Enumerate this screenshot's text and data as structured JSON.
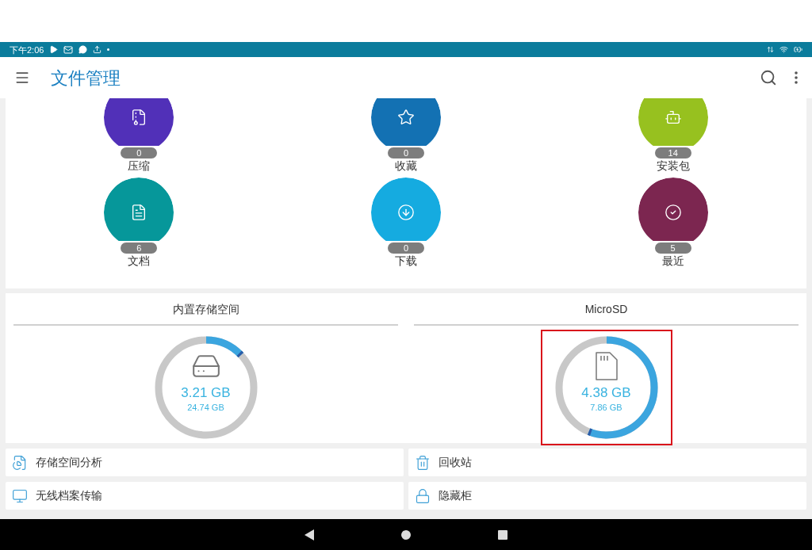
{
  "status_bar": {
    "time": "下午2:06"
  },
  "app_bar": {
    "title": "文件管理"
  },
  "categories": [
    {
      "label": "压缩",
      "count": "0",
      "color": "#5130b8",
      "kind": "archive"
    },
    {
      "label": "收藏",
      "count": "0",
      "color": "#1371b3",
      "kind": "favorite"
    },
    {
      "label": "安装包",
      "count": "14",
      "color": "#97c11f",
      "kind": "apk"
    },
    {
      "label": "文档",
      "count": "6",
      "color": "#06979a",
      "kind": "document"
    },
    {
      "label": "下载",
      "count": "0",
      "color": "#15abe0",
      "kind": "download"
    },
    {
      "label": "最近",
      "count": "5",
      "color": "#7c2650",
      "kind": "recent"
    }
  ],
  "storage": [
    {
      "title": "内置存储空间",
      "used": "3.21 GB",
      "total": "24.74 GB",
      "level": 0.13,
      "kind": "internal",
      "highlighted": false
    },
    {
      "title": "MicroSD",
      "used": "4.38 GB",
      "total": "7.86 GB",
      "level": 0.56,
      "kind": "sd",
      "highlighted": true
    }
  ],
  "tools": [
    {
      "label": "存储空间分析",
      "kind": "analysis"
    },
    {
      "label": "回收站",
      "kind": "trash"
    },
    {
      "label": "无线档案传输",
      "kind": "transfer"
    },
    {
      "label": "隐藏柜",
      "kind": "lock"
    }
  ]
}
